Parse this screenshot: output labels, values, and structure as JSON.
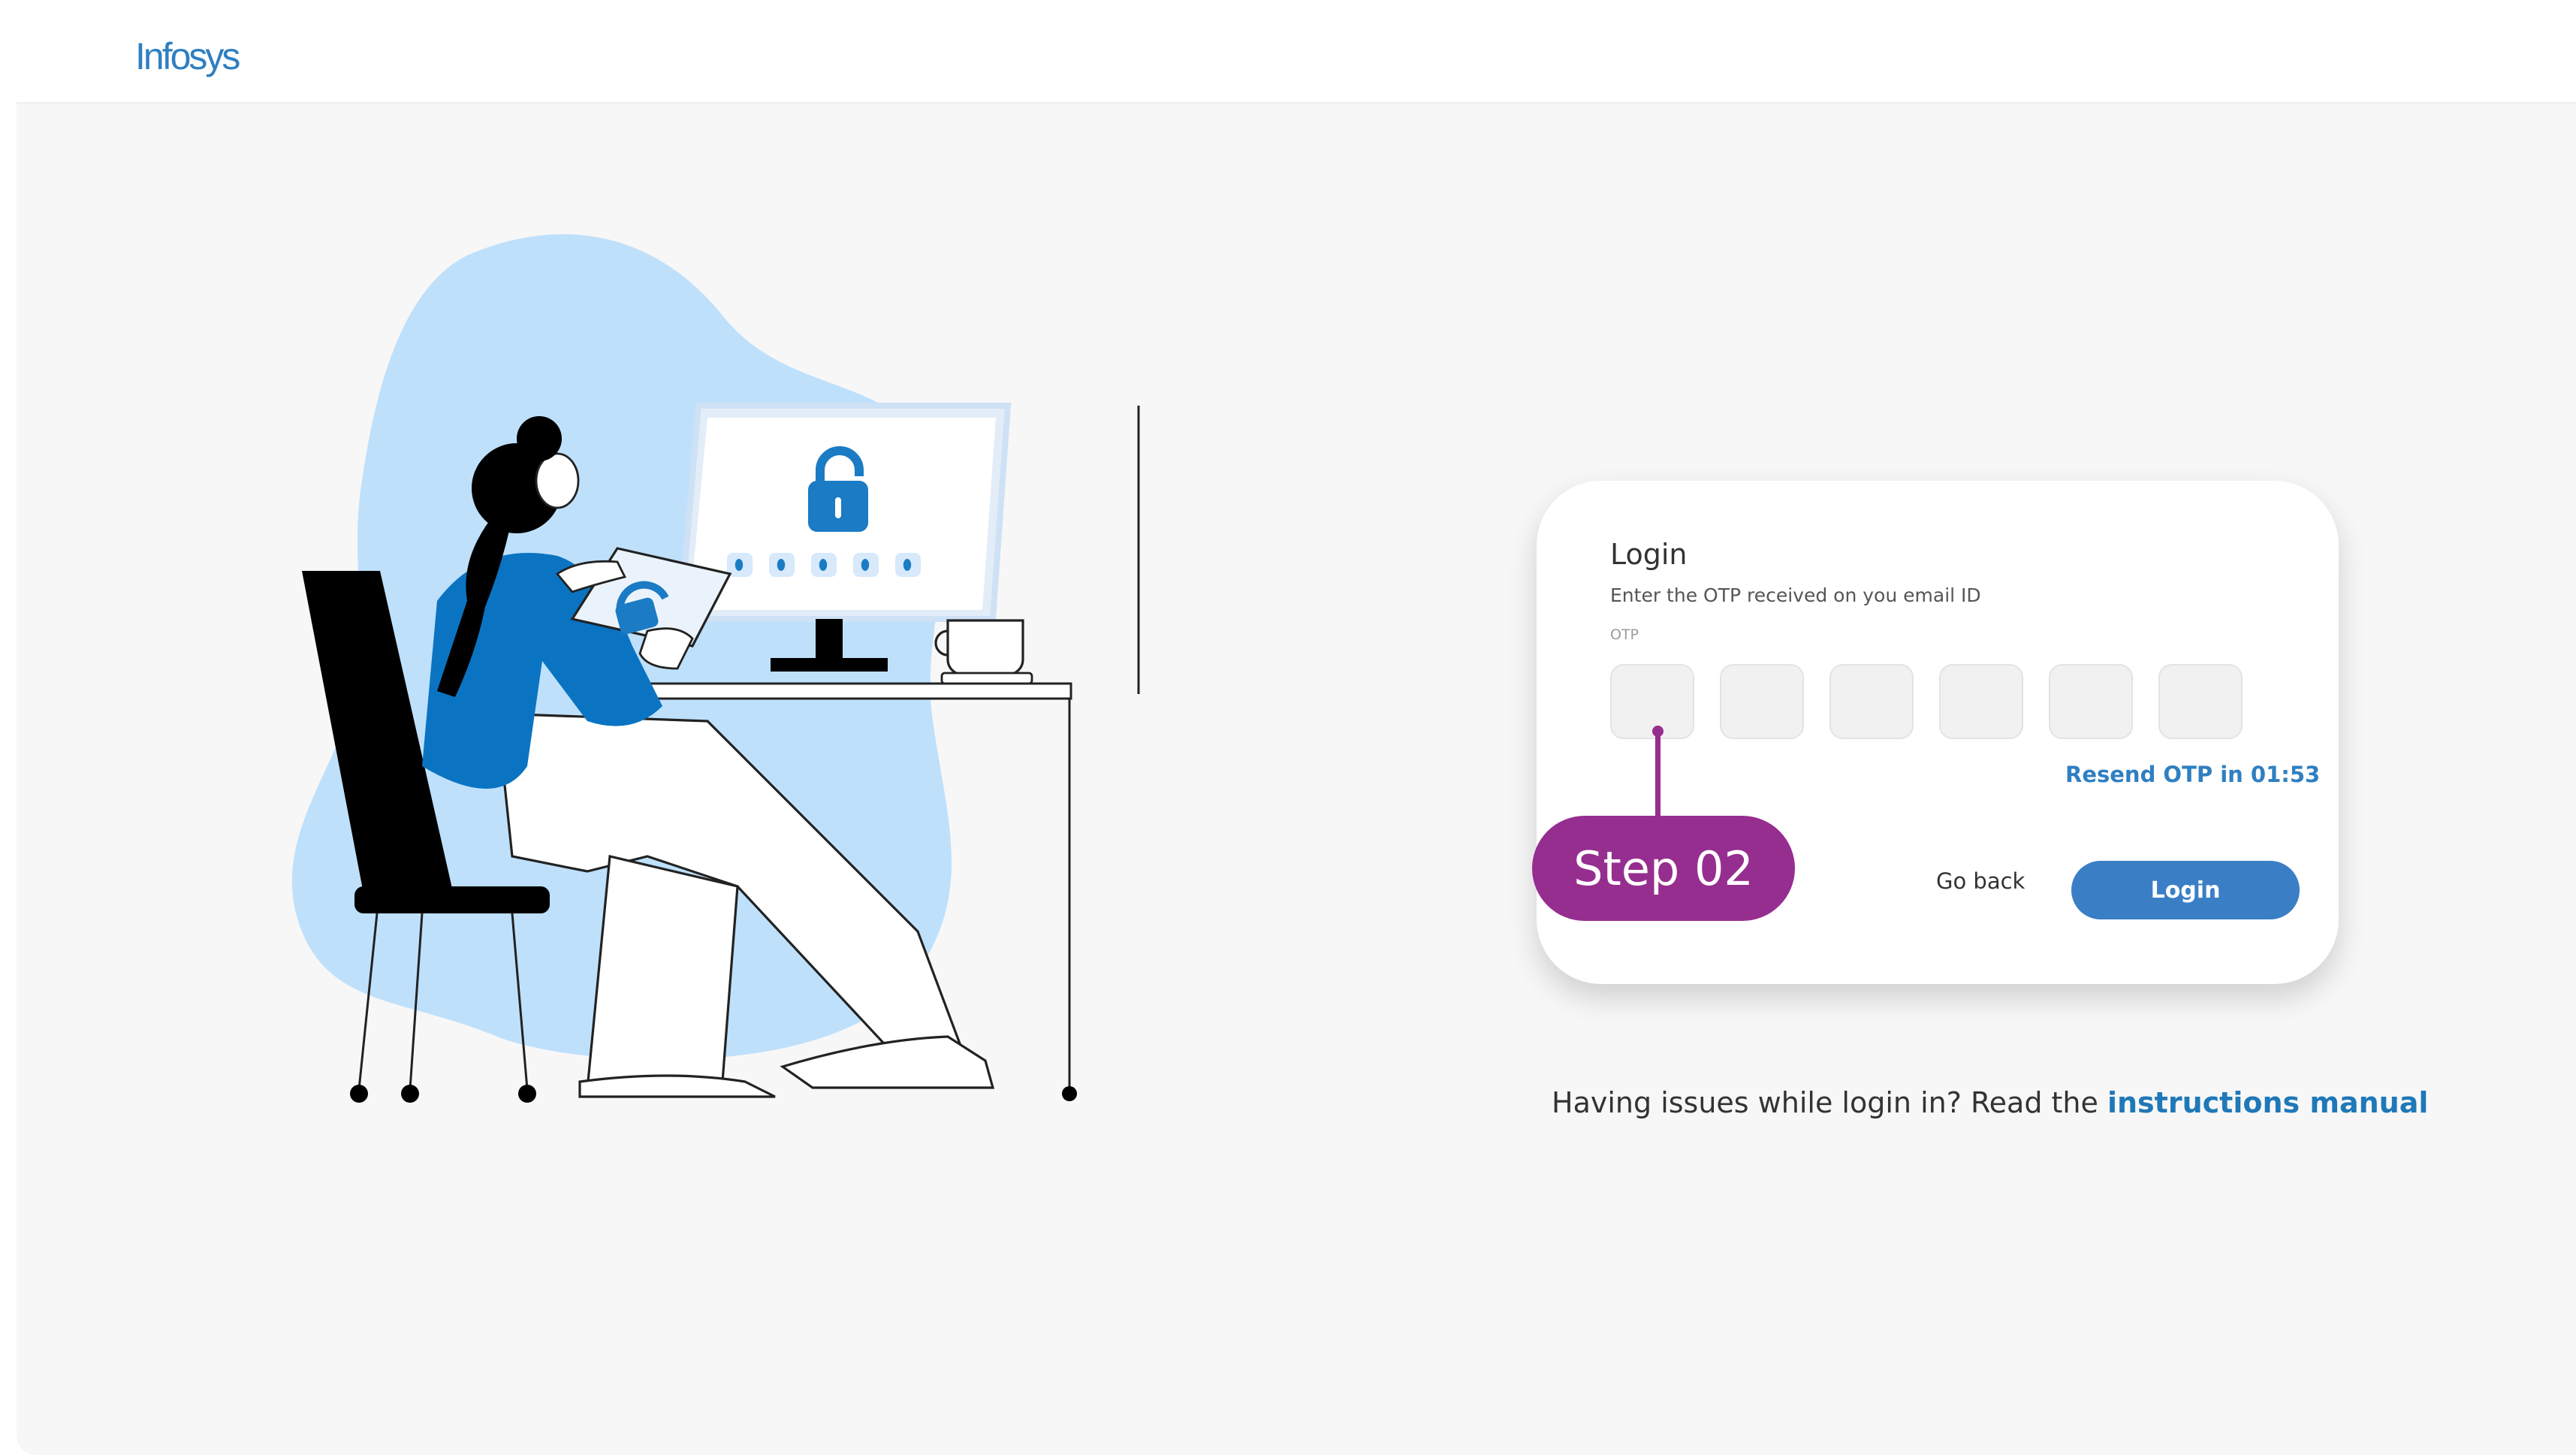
{
  "header": {
    "logo_text": "Infosys"
  },
  "login_card": {
    "title": "Login",
    "subtitle": "Enter the OTP received on you email ID",
    "otp_label": "OTP",
    "otp_digits": [
      "",
      "",
      "",
      "",
      "",
      ""
    ],
    "resend_text": "Resend OTP in 01:53",
    "go_back_label": "Go back",
    "login_label": "Login"
  },
  "annotation": {
    "step_label": "Step 02"
  },
  "help": {
    "prefix": "Having issues while login in? Read the ",
    "link_text": "instructions manual"
  },
  "colors": {
    "brand_blue": "#2f7fc1",
    "button_blue": "#3a7fc6",
    "step_purple": "#962e8f",
    "blob_blue": "#bfe0fb",
    "shirt_blue": "#0a74c2"
  }
}
